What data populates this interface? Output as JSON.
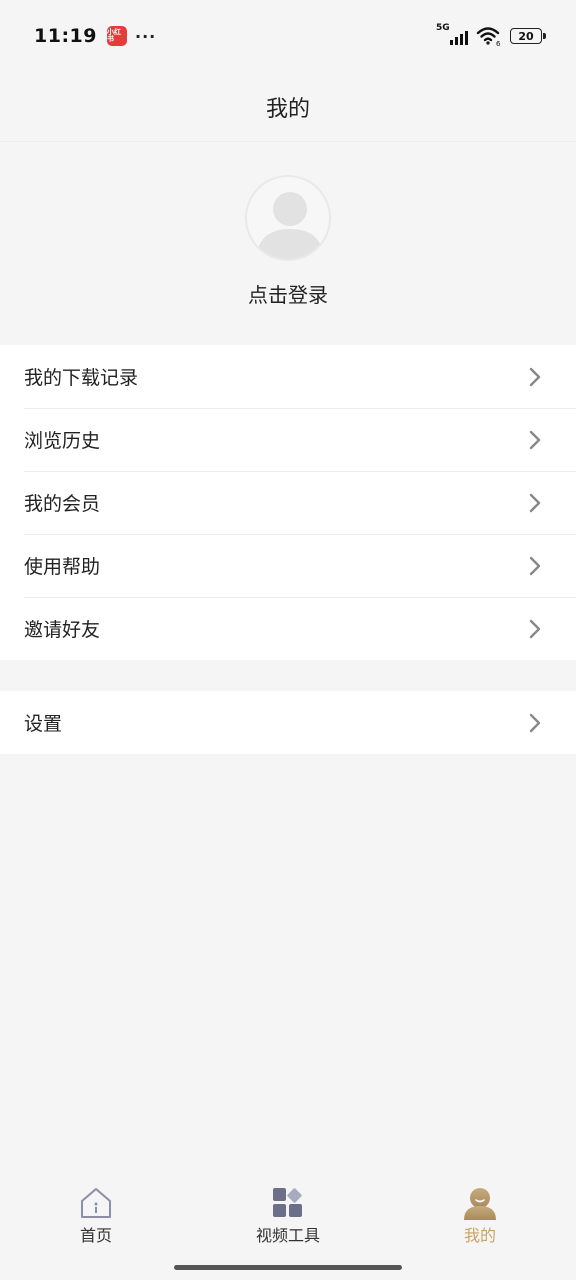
{
  "status_bar": {
    "time": "11:19",
    "app_badge": "小红书",
    "dots": "···",
    "network": "5G",
    "wifi_sub": "6",
    "battery": "20"
  },
  "header": {
    "title": "我的"
  },
  "profile": {
    "login_text": "点击登录"
  },
  "menu": {
    "items": [
      {
        "label": "我的下载记录"
      },
      {
        "label": "浏览历史"
      },
      {
        "label": "我的会员"
      },
      {
        "label": "使用帮助"
      },
      {
        "label": "邀请好友"
      }
    ],
    "settings": {
      "label": "设置"
    }
  },
  "tabs": [
    {
      "label": "首页",
      "icon": "home-icon"
    },
    {
      "label": "视频工具",
      "icon": "grid-tools-icon"
    },
    {
      "label": "我的",
      "icon": "profile-icon",
      "active": true
    }
  ],
  "colors": {
    "accent": "#c9a367",
    "tab_icon": "#6b6f8a"
  }
}
